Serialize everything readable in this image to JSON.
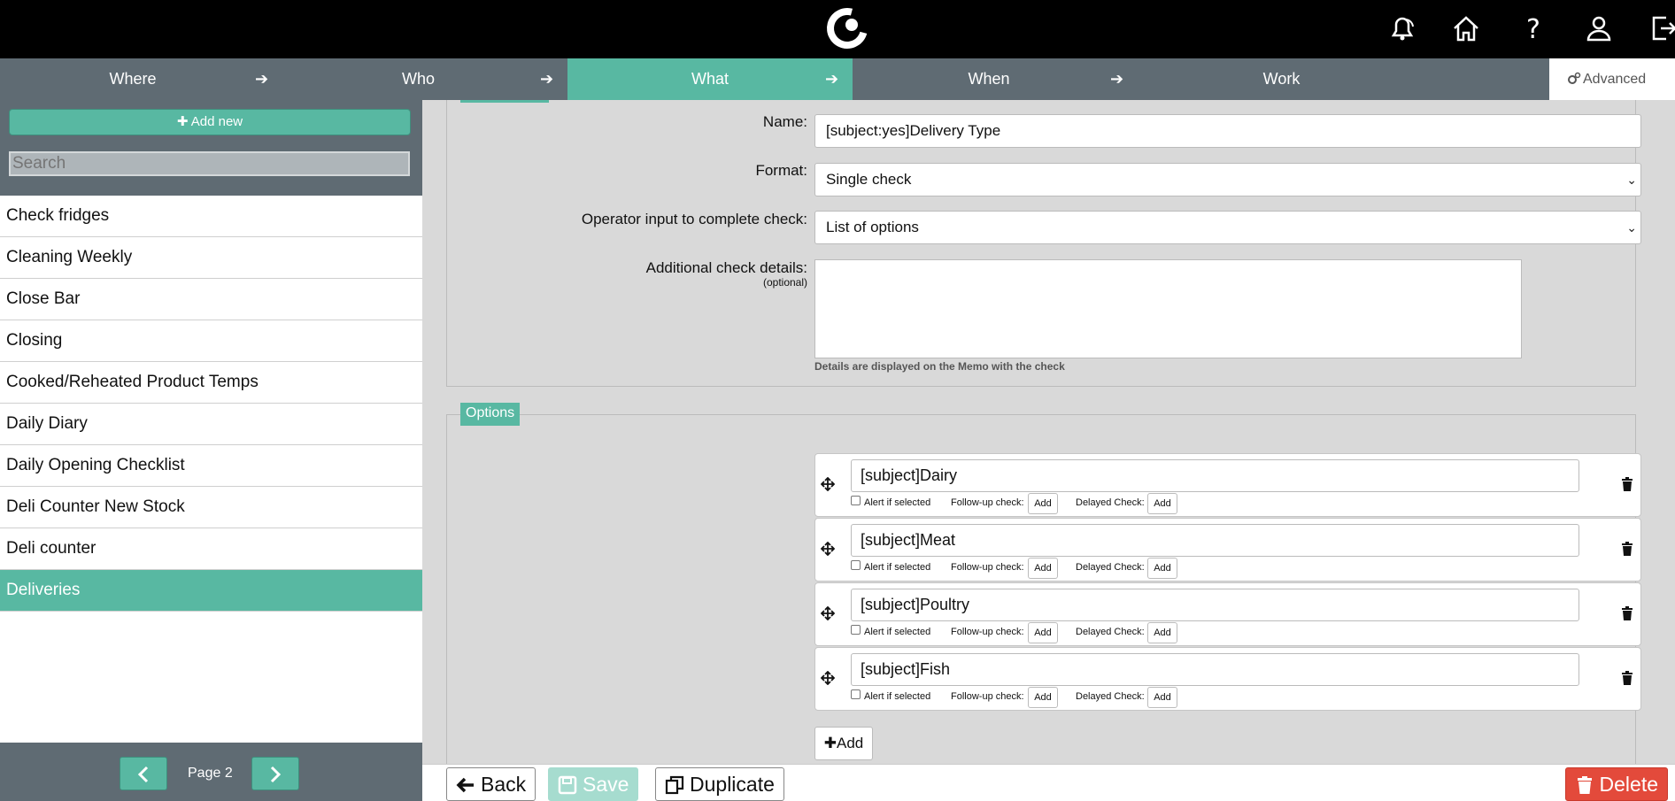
{
  "topbar": {
    "icons": [
      "logo-icon",
      "notification-bell-icon",
      "home-icon",
      "help-icon",
      "user-icon",
      "logout-icon"
    ]
  },
  "steps": [
    {
      "label": "Where"
    },
    {
      "label": "Who"
    },
    {
      "label": "What"
    },
    {
      "label": "When"
    },
    {
      "label": "Work"
    }
  ],
  "advanced": {
    "label": "Advanced"
  },
  "sidebar": {
    "add_new": "Add new",
    "search_placeholder": "Search",
    "items": [
      {
        "label": "Check fridges"
      },
      {
        "label": "Cleaning Weekly"
      },
      {
        "label": "Close Bar"
      },
      {
        "label": "Closing"
      },
      {
        "label": "Cooked/Reheated Product Temps"
      },
      {
        "label": "Daily Diary"
      },
      {
        "label": "Daily Opening Checklist"
      },
      {
        "label": "Deli Counter New Stock"
      },
      {
        "label": "Deli counter"
      },
      {
        "label": "Deliveries"
      }
    ],
    "pagination": {
      "label": "Page 2"
    }
  },
  "form": {
    "name_label": "Name:",
    "name_value": "[subject:yes]Delivery Type",
    "format_label": "Format:",
    "format_value": "Single check",
    "operator_label": "Operator input to complete check:",
    "operator_value": "List of options",
    "details_label": "Additional check details:",
    "details_optional": "(optional)",
    "details_hint": "Details are displayed on the Memo with the check"
  },
  "options": {
    "legend": "Options",
    "alert_label": "Alert if selected",
    "followup_label": "Follow-up check:",
    "delayed_label": "Delayed Check:",
    "add_small": "Add",
    "items": [
      {
        "value": "[subject]Dairy"
      },
      {
        "value": "[subject]Meat"
      },
      {
        "value": "[subject]Poultry"
      },
      {
        "value": "[subject]Fish"
      }
    ],
    "add_button": "Add"
  },
  "bottombar": {
    "back": "Back",
    "save": "Save",
    "duplicate": "Duplicate",
    "delete": "Delete"
  },
  "colors": {
    "accent": "#58b8a2",
    "nav": "#5f6b73",
    "delete": "#e34a3b"
  }
}
